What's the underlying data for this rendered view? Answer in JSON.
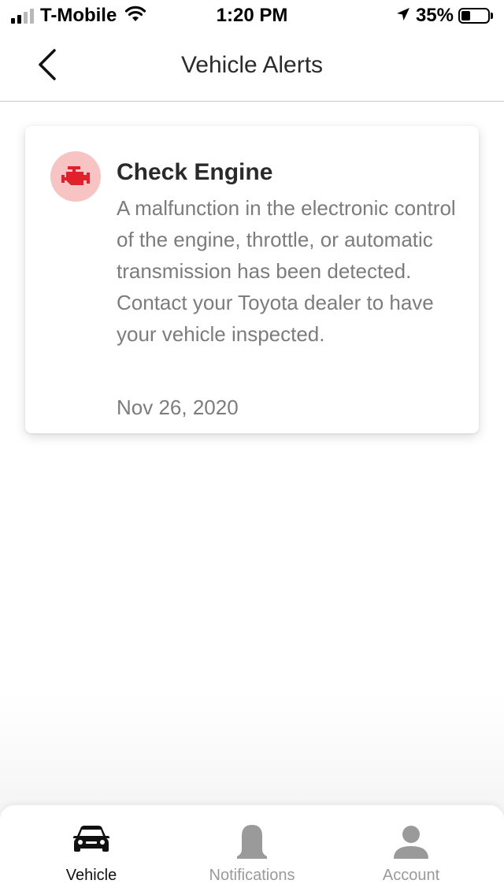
{
  "status_bar": {
    "carrier": "T-Mobile",
    "time": "1:20 PM",
    "battery_percent": "35%",
    "battery_level": 0.35,
    "signal_bars": 2,
    "icons": [
      "signal-icon",
      "wifi-icon",
      "location-arrow-icon",
      "battery-icon"
    ]
  },
  "nav": {
    "title": "Vehicle Alerts",
    "back_icon": "chevron-left-icon"
  },
  "alerts": [
    {
      "icon": "engine-icon",
      "icon_color": "#e0202a",
      "icon_bg": "#f7c3c3",
      "title": "Check Engine",
      "body": "A malfunction in the electronic control of the engine, throttle, or automatic transmission has been detected. Contact your Toyota dealer to have your vehicle inspected.",
      "date": "Nov 26, 2020"
    }
  ],
  "tabs": [
    {
      "label": "Vehicle",
      "icon": "car-icon",
      "active": true
    },
    {
      "label": "Notifications",
      "icon": "bell-icon",
      "active": false
    },
    {
      "label": "Account",
      "icon": "person-icon",
      "active": false
    }
  ]
}
